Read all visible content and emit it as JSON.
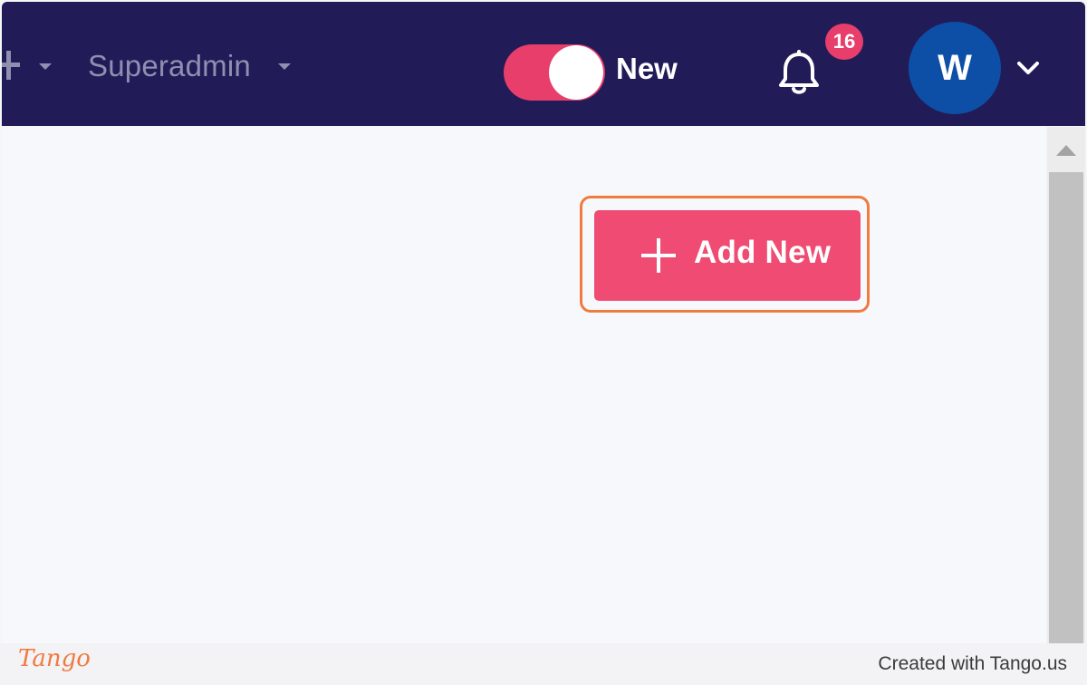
{
  "header": {
    "org_label": "Superadmin",
    "toggle_label": "New",
    "toggle_on": true,
    "notification_count": "16",
    "avatar_initial": "W"
  },
  "main": {
    "add_button_label": "Add New"
  },
  "footer": {
    "logo_text": "Tango",
    "credit_text": "Created with Tango.us"
  },
  "colors": {
    "topbar": "#211c57",
    "accent": "#ef4b73",
    "avatar": "#0d4ea6",
    "highlight": "#f07a3f"
  },
  "icons": [
    "plus-icon",
    "caret-down-icon",
    "bell-icon",
    "chevron-down-icon",
    "scroll-up-arrow-icon"
  ]
}
